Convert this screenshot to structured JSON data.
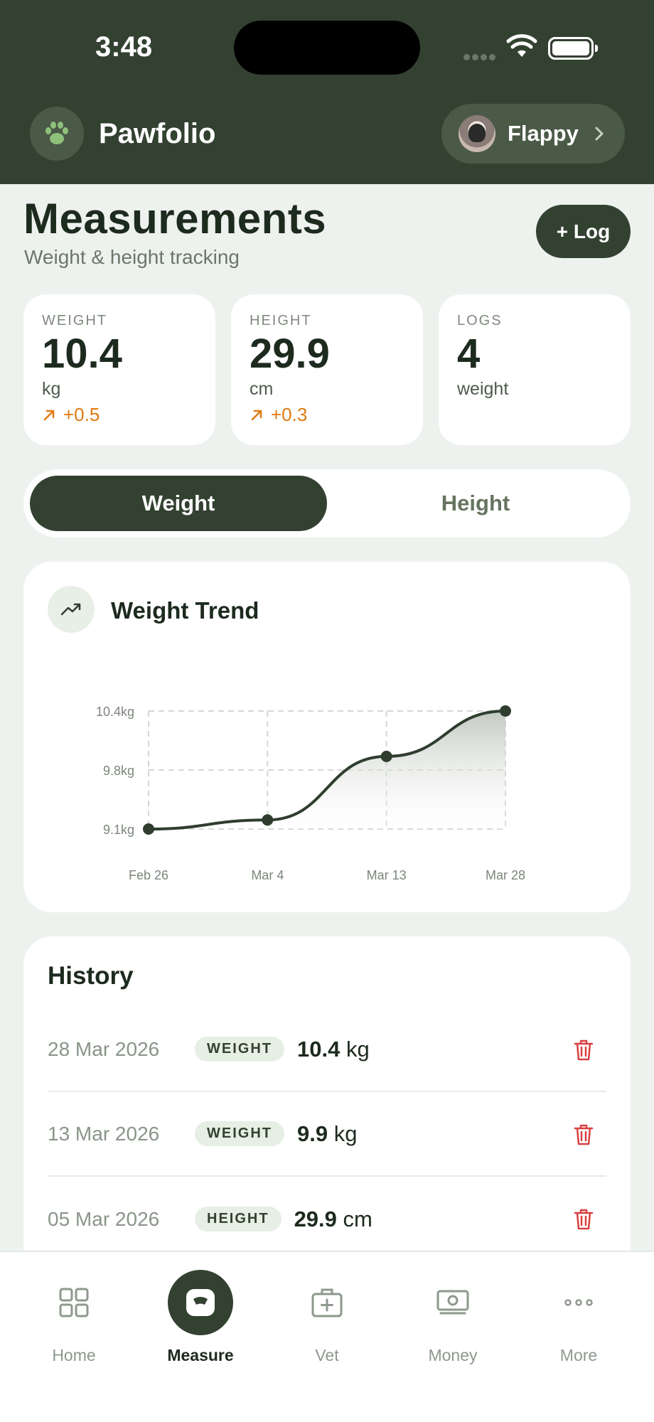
{
  "status_bar": {
    "time": "3:48"
  },
  "header": {
    "app_name": "Pawfolio",
    "logo_icon": "paw-icon",
    "pet_name": "Flappy"
  },
  "page": {
    "title": "Measurements",
    "subtitle": "Weight & height tracking",
    "log_button": "+ Log"
  },
  "stats": [
    {
      "label": "WEIGHT",
      "value": "10.4",
      "unit": "kg",
      "delta": "+0.5"
    },
    {
      "label": "HEIGHT",
      "value": "29.9",
      "unit": "cm",
      "delta": "+0.3"
    },
    {
      "label": "LOGS",
      "value": "4",
      "unit": "weight"
    }
  ],
  "segments": {
    "weight": "Weight",
    "height": "Height",
    "selected": "Weight"
  },
  "trend": {
    "title": "Weight Trend",
    "icon": "trending-up-icon"
  },
  "chart_data": {
    "type": "area",
    "title": "Weight Trend",
    "x": [
      "Feb 26",
      "Mar 4",
      "Mar 13",
      "Mar 28"
    ],
    "values": [
      9.1,
      9.2,
      9.9,
      10.4
    ],
    "y_ticks": [
      "10.4kg",
      "9.8kg",
      "9.1kg"
    ],
    "ylim": [
      9.1,
      10.4
    ],
    "grid": true,
    "colors": {
      "line": "#2f3d2e"
    }
  },
  "history": {
    "title": "History",
    "rows": [
      {
        "date": "28 Mar 2026",
        "badge": "WEIGHT",
        "value": "10.4",
        "unit": "kg"
      },
      {
        "date": "13 Mar 2026",
        "badge": "WEIGHT",
        "value": "9.9",
        "unit": "kg"
      },
      {
        "date": "05 Mar 2026",
        "badge": "HEIGHT",
        "value": "29.9",
        "unit": "cm"
      }
    ]
  },
  "nav": [
    {
      "label": "Home",
      "icon": "grid-icon"
    },
    {
      "label": "Measure",
      "icon": "scale-icon",
      "active": true
    },
    {
      "label": "Vet",
      "icon": "medical-kit-icon"
    },
    {
      "label": "Money",
      "icon": "banknote-icon"
    },
    {
      "label": "More",
      "icon": "more-icon"
    }
  ],
  "colors": {
    "brand_dark": "#334131",
    "accent_orange": "#e07a10",
    "delete_red": "#d84040",
    "background": "#eef2ef"
  }
}
